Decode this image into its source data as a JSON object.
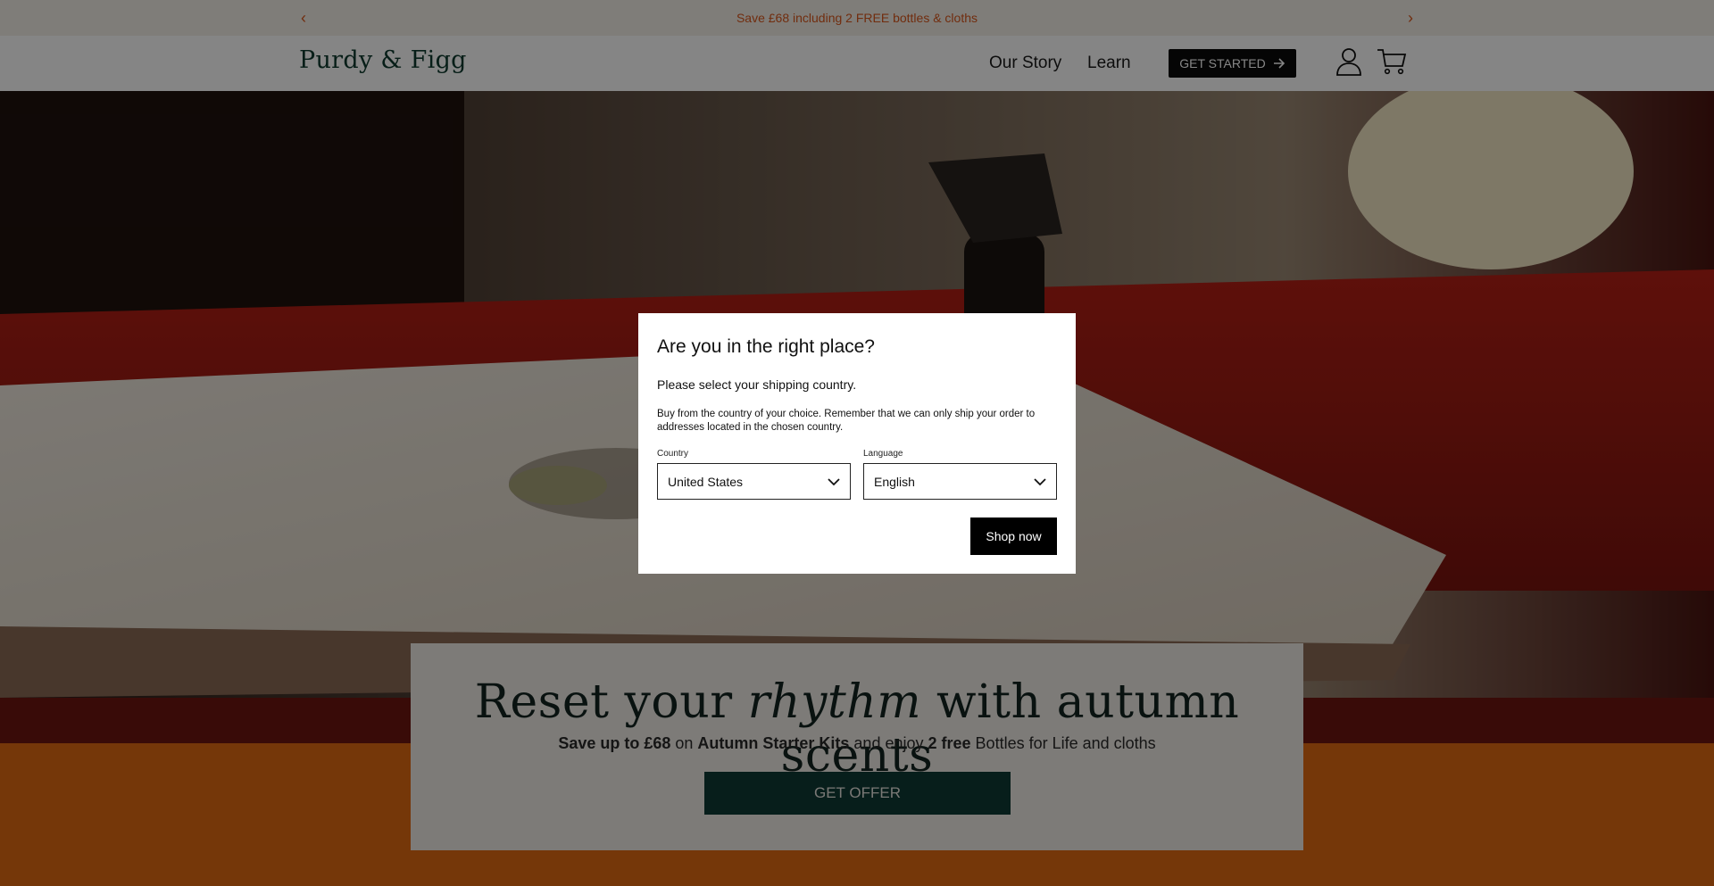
{
  "announcement": {
    "text": "Save £68 including 2 FREE bottles & cloths",
    "prev_icon": "chevron-left-icon",
    "next_icon": "chevron-right-icon",
    "color": "#d9561b"
  },
  "header": {
    "logo": "Purdy & Figg",
    "nav": [
      "Our Story",
      "Learn"
    ],
    "cta": "GET STARTED",
    "icons": [
      "account-icon",
      "cart-icon"
    ]
  },
  "hero": {
    "slide_count": 3,
    "active_slide": 1
  },
  "promo": {
    "title_before": "Reset your ",
    "title_em": "rhythm",
    "title_after": " with autumn scents",
    "sub_1": "Save up to £68",
    "sub_2": " on ",
    "sub_3": "Autumn Starter Kits",
    "sub_4": " and enjoy ",
    "sub_5": "2 free",
    "sub_6": " Bottles for Life and cloths",
    "button": "GET OFFER"
  },
  "modal": {
    "title": "Are you in the right place?",
    "lead": "Please select your shipping country.",
    "body": "Buy from the country of your choice. Remember that we can only ship your order to addresses located in the chosen country.",
    "country_label": "Country",
    "country_value": "United States",
    "language_label": "Language",
    "language_value": "English",
    "submit": "Shop now"
  },
  "colors": {
    "brand_green": "#0f3b2e",
    "accent_orange": "#e06a12",
    "promo_bg": "#f0ece6"
  }
}
